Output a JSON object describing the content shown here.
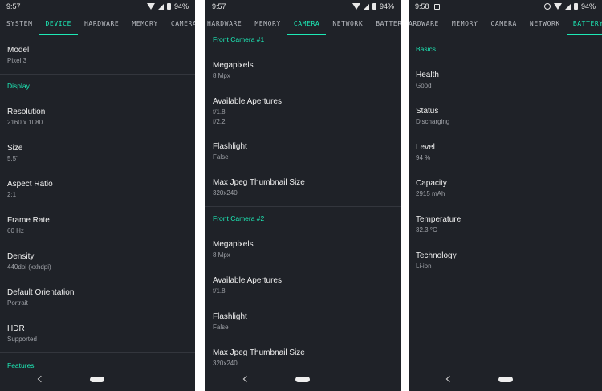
{
  "tabs_device": [
    "SYSTEM",
    "DEVICE",
    "HARDWARE",
    "MEMORY",
    "CAMERA"
  ],
  "tabs_camera": [
    "HARDWARE",
    "MEMORY",
    "CAMERA",
    "NETWORK",
    "BATTERY"
  ],
  "tabs_battery": [
    "ARDWARE",
    "MEMORY",
    "CAMERA",
    "NETWORK",
    "BATTERY"
  ],
  "screen1": {
    "time": "9:57",
    "battery": "94%",
    "model": {
      "title": "Model",
      "value": "Pixel 3"
    },
    "section_display": "Display",
    "items": [
      {
        "title": "Resolution",
        "value": "2160 x 1080"
      },
      {
        "title": "Size",
        "value": "5.5\""
      },
      {
        "title": "Aspect Ratio",
        "value": "2:1"
      },
      {
        "title": "Frame Rate",
        "value": "60 Hz"
      },
      {
        "title": "Density",
        "value": "440dpi (xxhdpi)"
      },
      {
        "title": "Default Orientation",
        "value": "Portrait"
      },
      {
        "title": "HDR",
        "value": "Supported"
      }
    ],
    "section_features": "Features"
  },
  "screen2": {
    "time": "9:57",
    "battery": "94%",
    "section1": "Front Camera #1",
    "cam1": [
      {
        "title": "Megapixels",
        "value": "8 Mpx"
      },
      {
        "title": "Available Apertures",
        "value": "f/1.8",
        "value2": "f/2.2"
      },
      {
        "title": "Flashlight",
        "value": "False"
      },
      {
        "title": "Max Jpeg Thumbnail Size",
        "value": "320x240"
      }
    ],
    "section2": "Front Camera #2",
    "cam2": [
      {
        "title": "Megapixels",
        "value": "8 Mpx"
      },
      {
        "title": "Available Apertures",
        "value": "f/1.8"
      },
      {
        "title": "Flashlight",
        "value": "False"
      },
      {
        "title": "Max Jpeg Thumbnail Size",
        "value": "320x240"
      }
    ]
  },
  "screen3": {
    "time": "9:58",
    "battery": "94%",
    "section": "Basics",
    "items": [
      {
        "title": "Health",
        "value": "Good"
      },
      {
        "title": "Status",
        "value": "Discharging"
      },
      {
        "title": "Level",
        "value": "94 %"
      },
      {
        "title": "Capacity",
        "value": "2915 mAh"
      },
      {
        "title": "Temperature",
        "value": "32.3 °C"
      },
      {
        "title": "Technology",
        "value": "Li-ion"
      }
    ]
  }
}
